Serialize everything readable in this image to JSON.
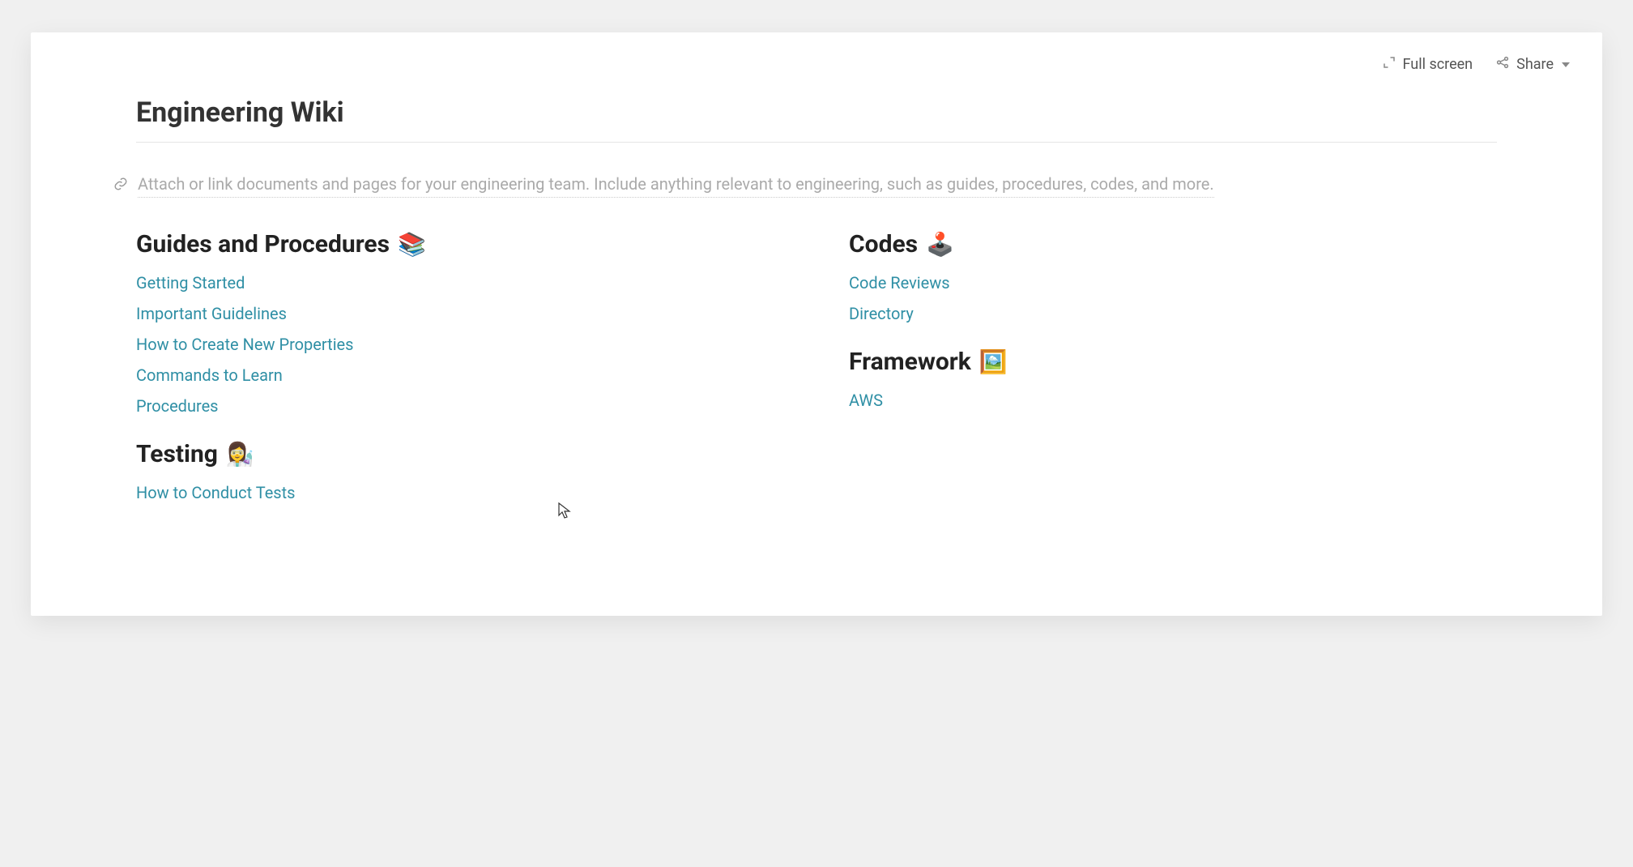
{
  "toolbar": {
    "fullscreen_label": "Full screen",
    "share_label": "Share"
  },
  "page": {
    "title": "Engineering Wiki",
    "description": "Attach or link documents and pages for your engineering team. Include anything relevant to engineering, such as guides, procedures, codes, and more."
  },
  "sections": {
    "guides": {
      "title": "Guides and Procedures",
      "emoji": "📚",
      "links": [
        "Getting Started",
        "Important Guidelines",
        "How to Create New Properties",
        "Commands to Learn",
        "Procedures"
      ]
    },
    "testing": {
      "title": "Testing",
      "emoji": "👩‍🔬",
      "links": [
        "How to Conduct Tests"
      ]
    },
    "codes": {
      "title": "Codes",
      "emoji": "🕹️",
      "links": [
        "Code Reviews",
        "Directory"
      ]
    },
    "framework": {
      "title": "Framework",
      "emoji": "🖼️",
      "links": [
        "AWS"
      ]
    }
  }
}
